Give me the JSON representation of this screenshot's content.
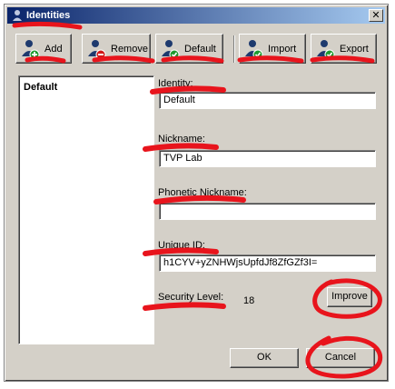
{
  "window": {
    "title": "Identities",
    "close_glyph": "✕"
  },
  "toolbar": {
    "add_label": "Add",
    "remove_label": "Remove",
    "default_label": "Default",
    "import_label": "Import",
    "export_label": "Export"
  },
  "list": {
    "items": [
      "Default"
    ]
  },
  "form": {
    "identity_label": "Identity:",
    "identity_value": "Default",
    "nickname_label": "Nickname:",
    "nickname_value": "TVP Lab",
    "phonetic_label": "Phonetic Nickname:",
    "phonetic_value": "",
    "unique_id_label": "Unique ID:",
    "unique_id_value": "h1CYV+yZNHWjsUpfdJf8ZfGZf3I=",
    "security_label": "Security Level:",
    "security_value": "18",
    "improve_label": "Improve"
  },
  "footer": {
    "ok_label": "OK",
    "cancel_label": "Cancel"
  },
  "colors": {
    "face": "#d4d0c8",
    "title_start": "#0a246a",
    "title_end": "#a6caf0",
    "annotation_red": "#e8141c"
  },
  "icons": {
    "title": "identities-icon",
    "add": "user-add-icon",
    "remove": "user-remove-icon",
    "default": "user-check-icon",
    "import": "user-import-icon",
    "export": "user-export-icon"
  }
}
